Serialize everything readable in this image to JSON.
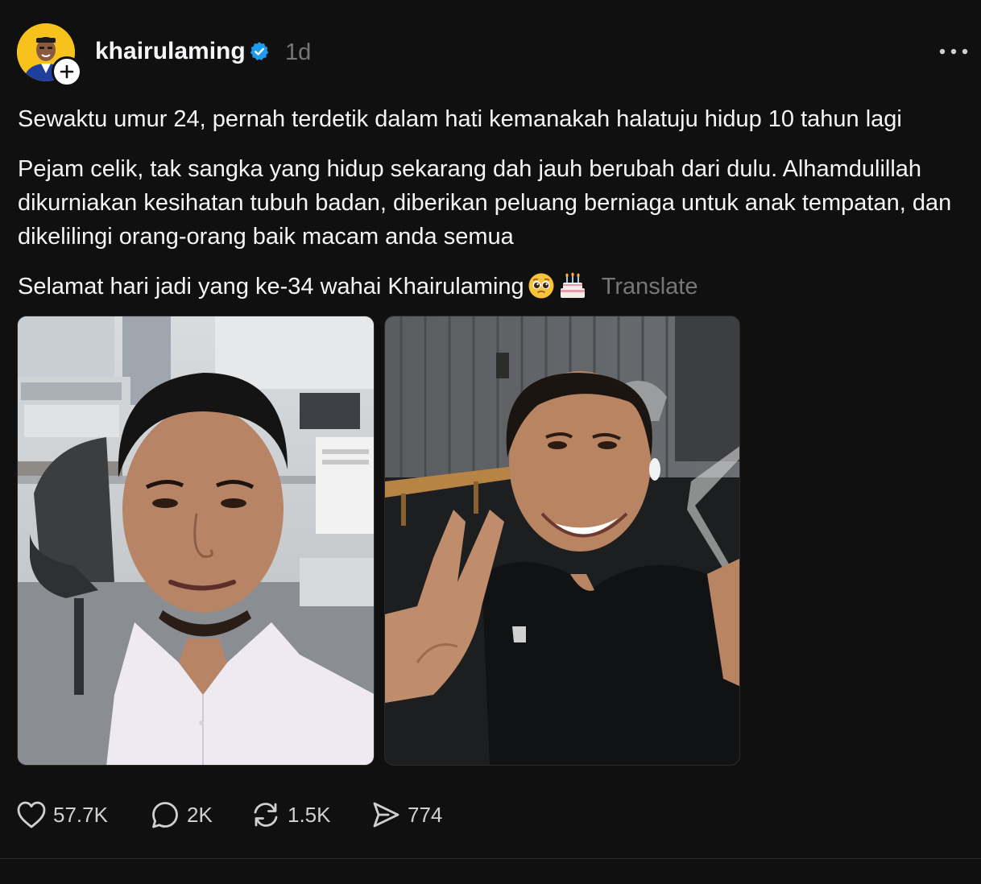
{
  "post": {
    "username": "khairulaming",
    "time": "1d",
    "paragraphs": [
      "Sewaktu umur 24, pernah terdetik dalam hati kemanakah halatuju hidup 10 tahun lagi",
      "Pejam celik, tak sangka yang hidup sekarang dah jauh berubah dari dulu. Alhamdulillah dikurniakan kesihatan tubuh badan, diberikan peluang berniaga untuk anak tempatan, dan dikelilingi orang-orang baik macam anda semua",
      "Selamat hari jadi yang ke-34 wahai Khairulaming"
    ],
    "emojis": [
      "pleading-face",
      "birthday-cake"
    ],
    "translate_label": "Translate",
    "images": [
      "office-selfie-photo",
      "gym-selfie-photo"
    ]
  },
  "actions": {
    "likes": "57.7K",
    "replies": "2K",
    "reposts": "1.5K",
    "shares": "774"
  },
  "colors": {
    "background": "#101010",
    "text": "#f3f5f7",
    "secondary": "#777777",
    "verified": "#1d9bf0",
    "avatar_bg": "#f6c21b"
  }
}
